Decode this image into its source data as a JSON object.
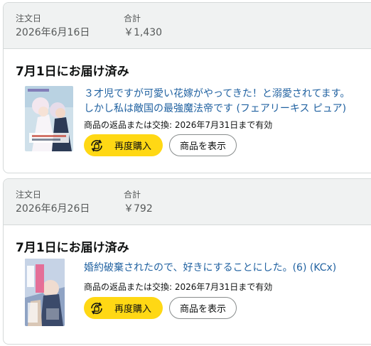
{
  "orders": [
    {
      "header": {
        "order_date_label": "注文日",
        "order_date": "2026年6月16日",
        "total_label": "合計",
        "total": "￥1,430"
      },
      "delivery_status": "7月1日にお届け済み",
      "product_title": "３才児ですが可愛い花嫁がやってきた！と溺愛されてます。しかし私は敵国の最強魔法帝です (フェアリーキス ピュア)",
      "return_text": "商品の返品または交換: 2026年7月31日まで有効",
      "rebuy_label": "再度購入",
      "view_label": "商品を表示"
    },
    {
      "header": {
        "order_date_label": "注文日",
        "order_date": "2026年6月26日",
        "total_label": "合計",
        "total": "￥792"
      },
      "delivery_status": "7月1日にお届け済み",
      "product_title": "婚約破棄されたので、好きにすることにした。(6) (KCx)",
      "return_text": "商品の返品または交換: 2026年7月31日まで有効",
      "rebuy_label": "再度購入",
      "view_label": "商品を表示"
    }
  ],
  "colors": {
    "header_bg": "#f0f2f2",
    "link": "#2162a1",
    "rebuy_button": "#ffd814",
    "border": "#d5d9d9"
  },
  "icons": {
    "rebuy": "rebuy-cycle-bag-icon"
  }
}
